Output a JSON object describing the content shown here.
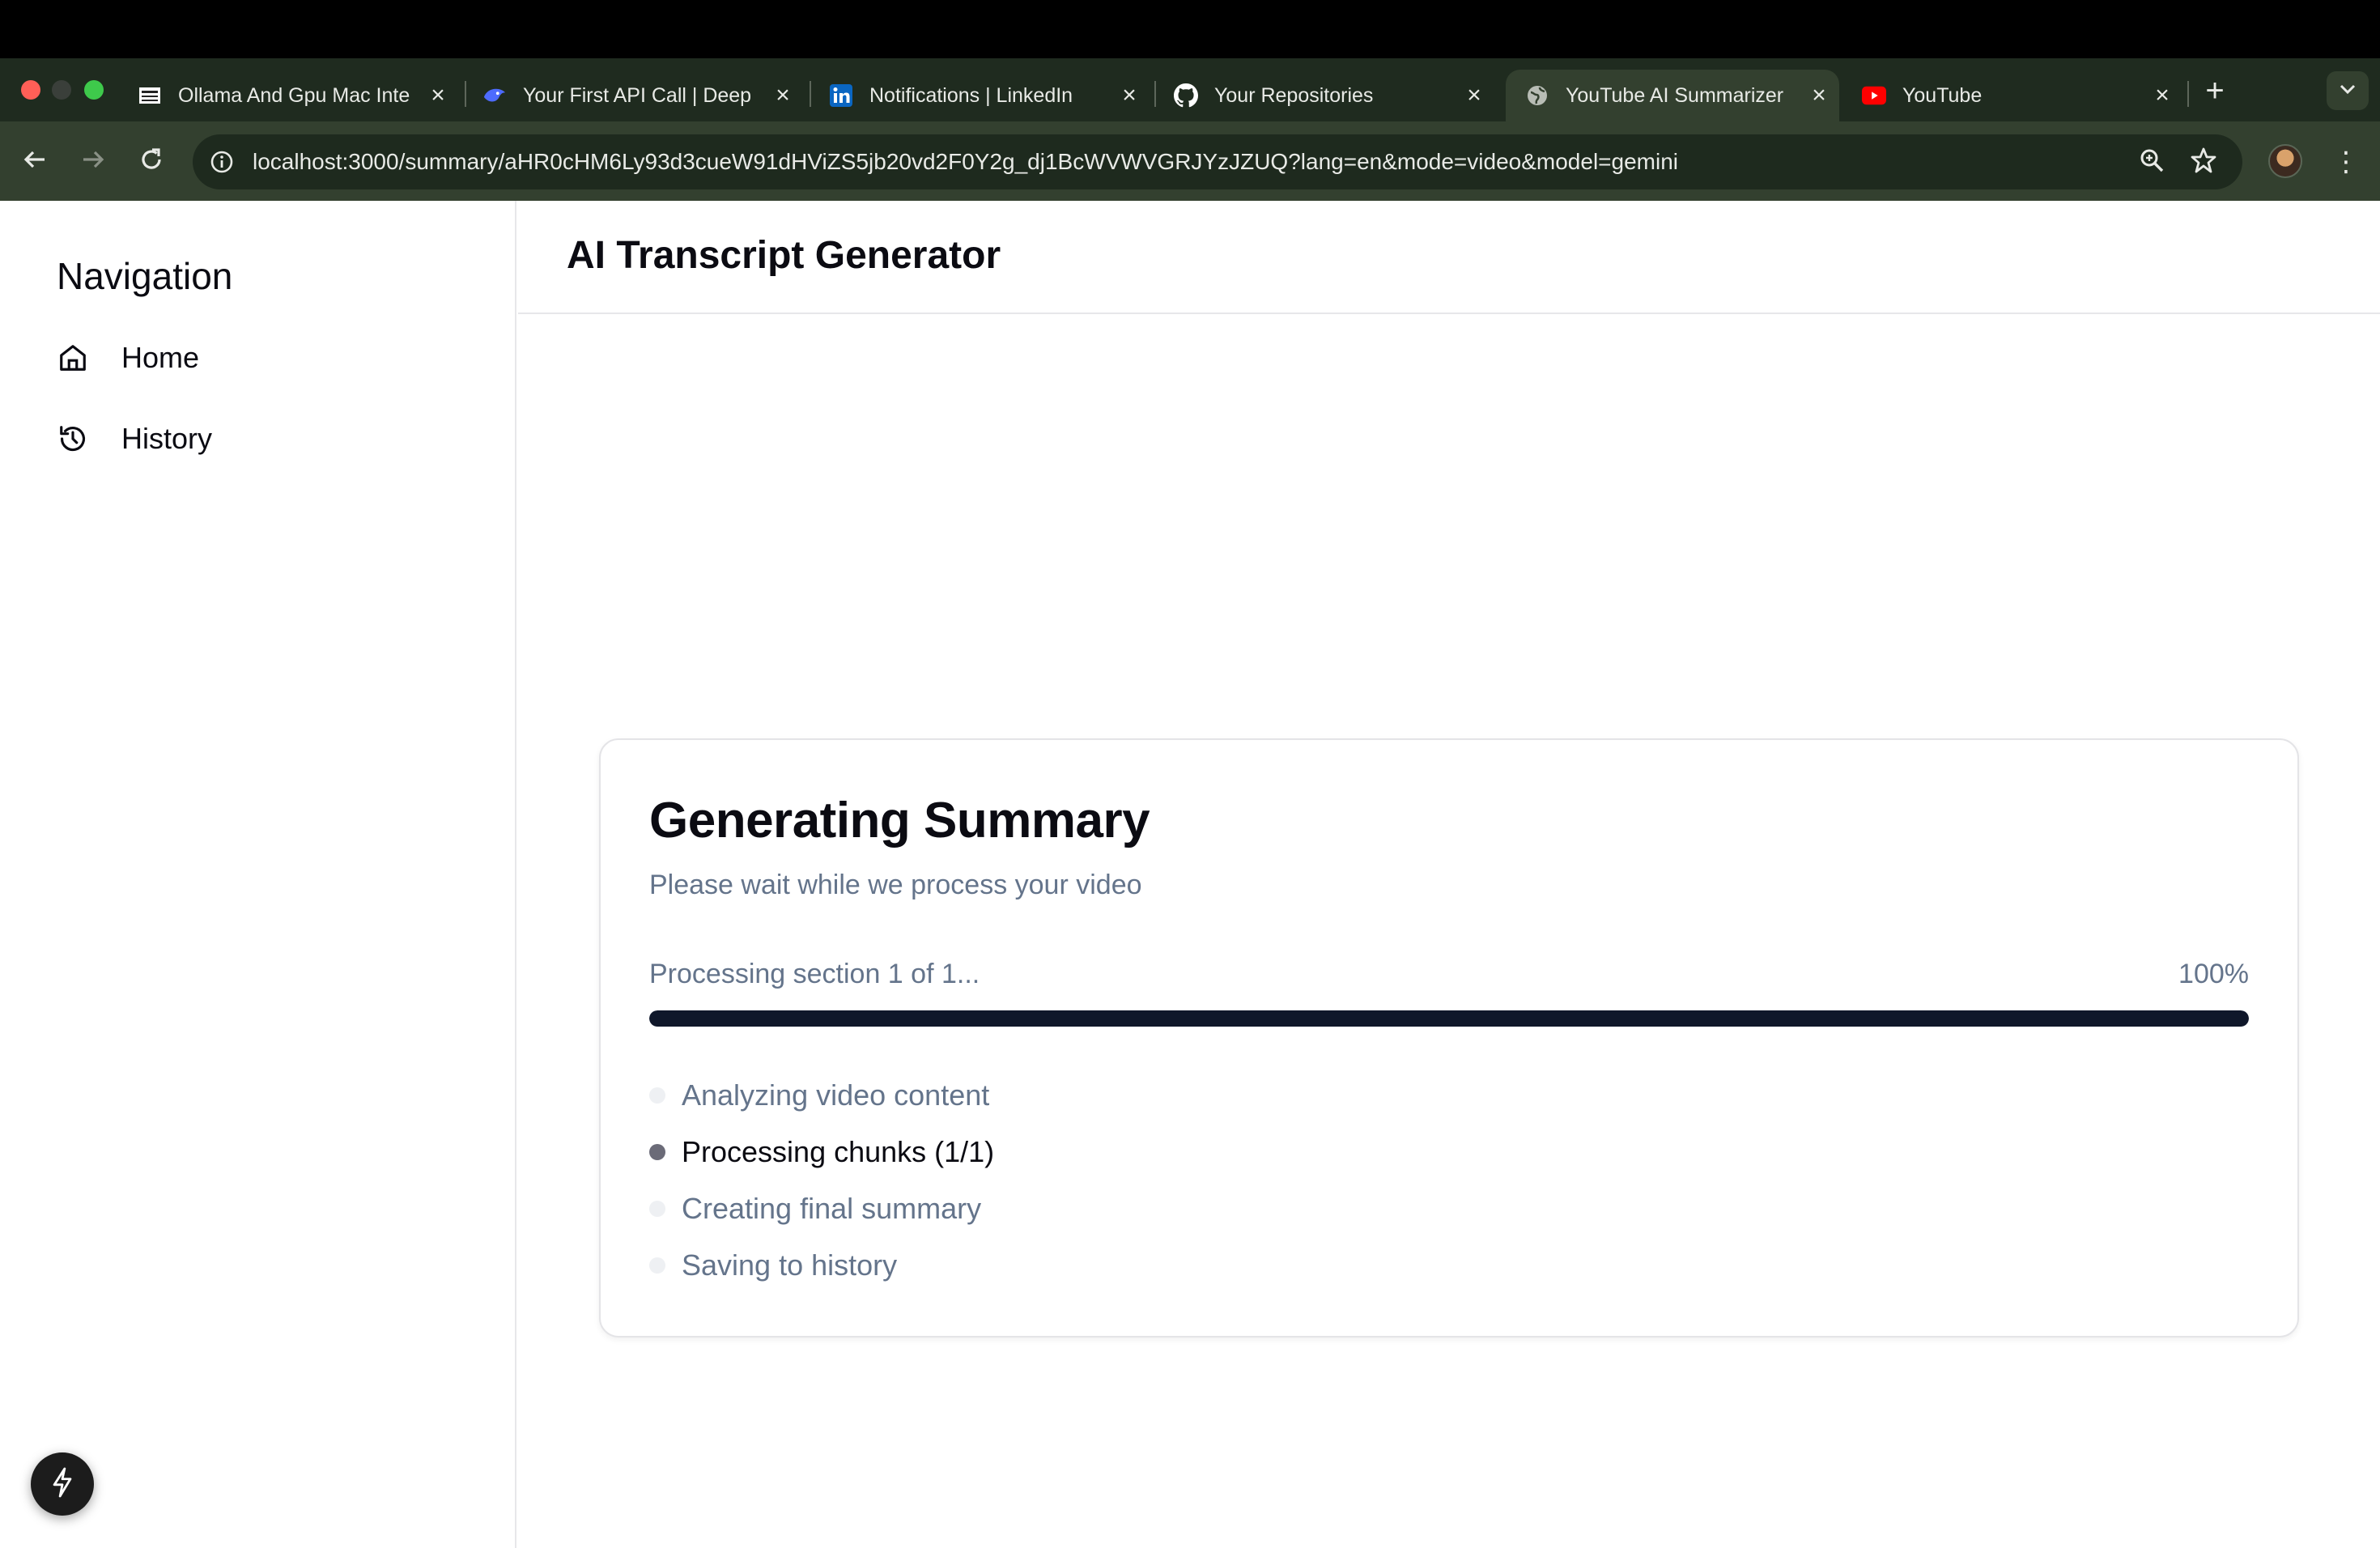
{
  "browser": {
    "tabs": [
      {
        "title": "Ollama And Gpu Mac Inte",
        "favicon": "document-icon"
      },
      {
        "title": "Your First API Call | Deep",
        "favicon": "deepseek-icon"
      },
      {
        "title": "Notifications | LinkedIn",
        "favicon": "linkedin-icon"
      },
      {
        "title": "Your Repositories",
        "favicon": "github-icon"
      },
      {
        "title": "YouTube AI Summarizer",
        "favicon": "globe-icon",
        "active": true
      },
      {
        "title": "YouTube",
        "favicon": "youtube-icon"
      }
    ],
    "url": "localhost:3000/summary/aHR0cHM6Ly93d3cueW91dHViZS5jb20vd2F0Y2g_dj1BcWVWVGRJYzJZUQ?lang=en&mode=video&model=gemini",
    "colors": {
      "tab_strip": "#1f2b1f",
      "toolbar": "#33402f"
    }
  },
  "sidebar": {
    "heading": "Navigation",
    "items": [
      {
        "label": "Home",
        "icon": "home-icon"
      },
      {
        "label": "History",
        "icon": "history-icon"
      }
    ]
  },
  "header": {
    "title": "AI Transcript Generator"
  },
  "progress_card": {
    "title": "Generating Summary",
    "subtitle": "Please wait while we process your video",
    "status": "Processing section 1 of 1...",
    "percent_label": "100%",
    "percent": 100,
    "steps": [
      {
        "label": "Analyzing video content",
        "active": false
      },
      {
        "label": "Processing chunks (1/1)",
        "active": true
      },
      {
        "label": "Creating final summary",
        "active": false
      },
      {
        "label": "Saving to history",
        "active": false
      }
    ]
  },
  "fab": {
    "icon": "lightning-icon"
  }
}
